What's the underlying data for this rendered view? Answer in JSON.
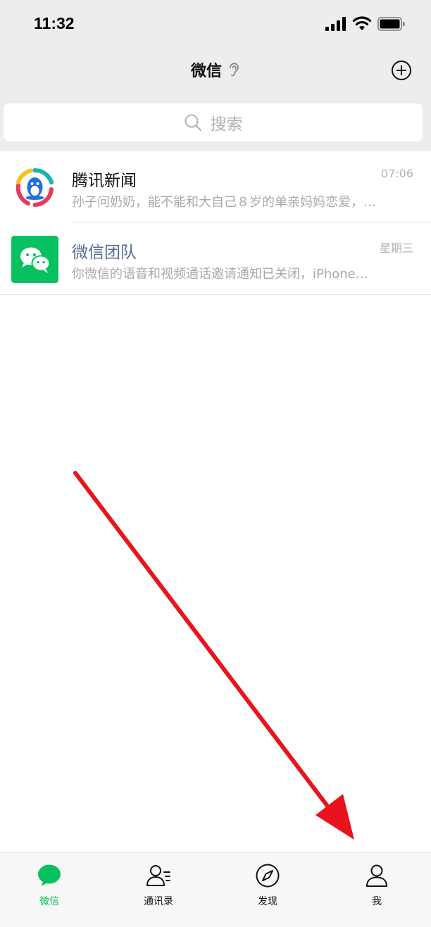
{
  "status_bar": {
    "time": "11:32"
  },
  "nav": {
    "title": "微信"
  },
  "search": {
    "placeholder": "搜索"
  },
  "chats": [
    {
      "name": "腾讯新闻",
      "time": "07:06",
      "preview": "孙子问奶奶，能不能和大自己８岁的单亲妈妈恋爱，…"
    },
    {
      "name": "微信团队",
      "time": "星期三",
      "preview": "你微信的语音和视频通话邀请通知已关闭，iPhone…"
    }
  ],
  "tabs": [
    {
      "label": "微信",
      "icon": "chat-bubble-icon",
      "active": true
    },
    {
      "label": "通讯录",
      "icon": "contacts-icon",
      "active": false
    },
    {
      "label": "发现",
      "icon": "compass-icon",
      "active": false
    },
    {
      "label": "我",
      "icon": "person-icon",
      "active": false
    }
  ],
  "colors": {
    "accent": "#07c160",
    "header_bg": "#ededed",
    "annotation_arrow": "#e8141b",
    "official_name": "#576b95"
  }
}
